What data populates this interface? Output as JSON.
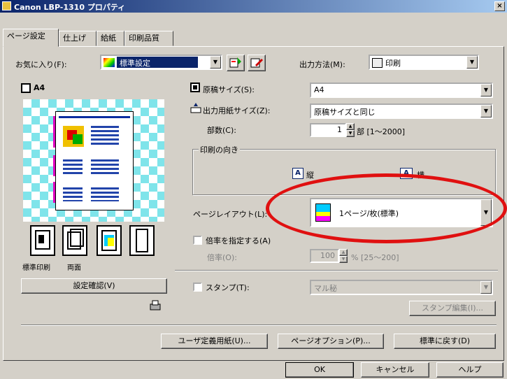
{
  "window": {
    "title": "Canon LBP-1310 プロパティ",
    "close_glyph": "×"
  },
  "tabs": [
    {
      "label": "ページ設定"
    },
    {
      "label": "仕上げ"
    },
    {
      "label": "給紙"
    },
    {
      "label": "印刷品質"
    }
  ],
  "favorites": {
    "label": "お気に入り(F):",
    "value": "標準設定"
  },
  "output": {
    "label": "出力方法(M):",
    "value": "印刷"
  },
  "preview": {
    "label": "A4"
  },
  "page_size": {
    "label": "原稿サイズ(S):",
    "value": "A4"
  },
  "output_size": {
    "label": "出力用紙サイズ(Z):",
    "value": "原稿サイズと同じ"
  },
  "copies": {
    "label": "部数(C):",
    "value": "1",
    "range": "部 [1～2000]"
  },
  "orientation": {
    "group_label": "印刷の向き",
    "portrait": "縦",
    "landscape": "横"
  },
  "page_layout": {
    "label": "ページレイアウト(L):",
    "value": "1ページ/枚(標準)"
  },
  "manual_scaling": {
    "label": "倍率を指定する(A)",
    "scale_label": "倍率(O):",
    "scale_value": "100",
    "scale_range": "% [25～200]"
  },
  "stamp": {
    "label": "スタンプ(T):",
    "value": "マル秘",
    "edit_button": "スタンプ編集(I)..."
  },
  "mode_labels": {
    "left": "標準印刷",
    "right": "両面"
  },
  "preview_settings_button": "設定確認(V)",
  "bottom_buttons": {
    "user_paper": "ユーザ定義用紙(U)...",
    "page_options": "ページオプション(P)...",
    "restore": "標準に戻す(D)"
  },
  "dialog_buttons": {
    "ok": "OK",
    "cancel": "キャンセル",
    "help": "ヘルプ"
  },
  "colors": {
    "accent_red": "#e01010",
    "title_blue": "#0a246a",
    "preview_cyan": "#7fe4ea"
  }
}
